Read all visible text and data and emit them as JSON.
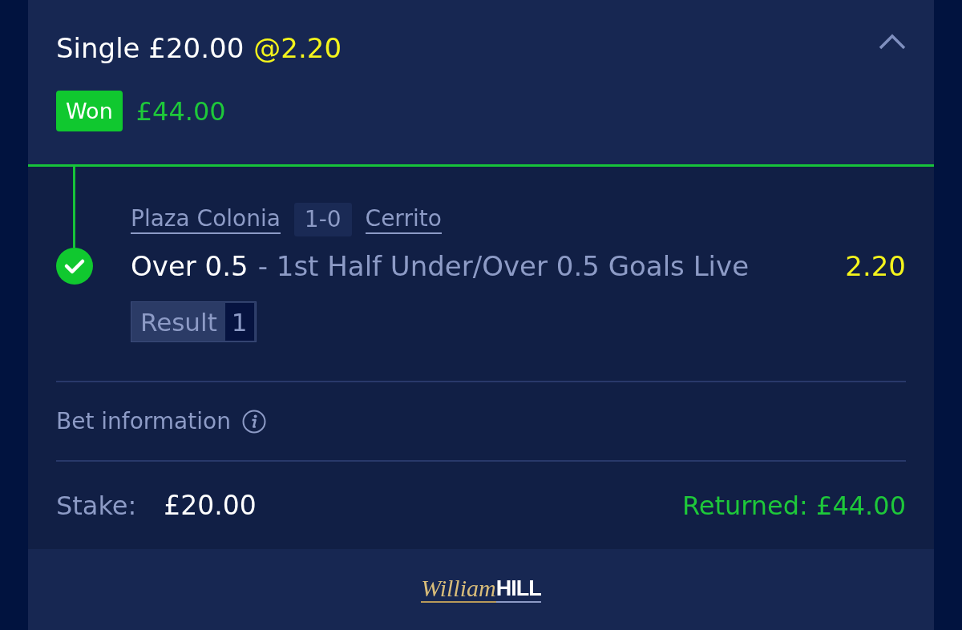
{
  "bet": {
    "title": "Single £20.00",
    "odds": "@2.20",
    "expanded": true
  },
  "status": {
    "kind": "won",
    "label": "Won",
    "amount": "£44.00"
  },
  "selection": {
    "home_team": "Plaza Colonia",
    "score": "1-0",
    "away_team": "Cerrito",
    "pick": "Over 0.5",
    "market": "- 1st Half Under/Over 0.5 Goals Live",
    "odds": "2.20",
    "won": true,
    "result_label": "Result",
    "result_value": "1"
  },
  "bet_information": {
    "label": "Bet information"
  },
  "totals": {
    "stake_label": "Stake:",
    "stake": "£20.00",
    "returned": "Returned: £44.00"
  },
  "footer": {
    "logo_script": "William",
    "logo_bold": "HILL"
  }
}
